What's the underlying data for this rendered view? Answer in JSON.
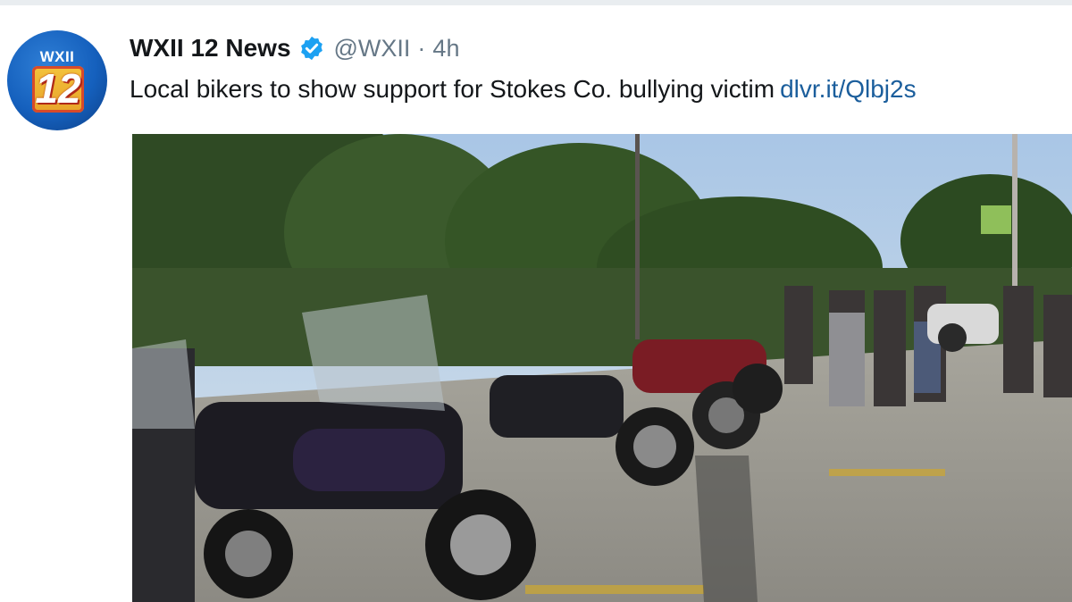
{
  "tweet": {
    "avatar": {
      "logo_text": "WXII",
      "logo_number": "12"
    },
    "display_name": "WXII 12 News",
    "handle": "@WXII",
    "separator": "·",
    "timestamp": "4h",
    "text": "Local bikers to show support for Stokes Co. bullying victim",
    "link": "dlvr.it/Qlbj2s",
    "icons": {
      "verified": "verified-badge-icon"
    },
    "colors": {
      "link": "#1b5e9c",
      "verified": "#1da1f2",
      "secondary_text": "#657786"
    }
  }
}
